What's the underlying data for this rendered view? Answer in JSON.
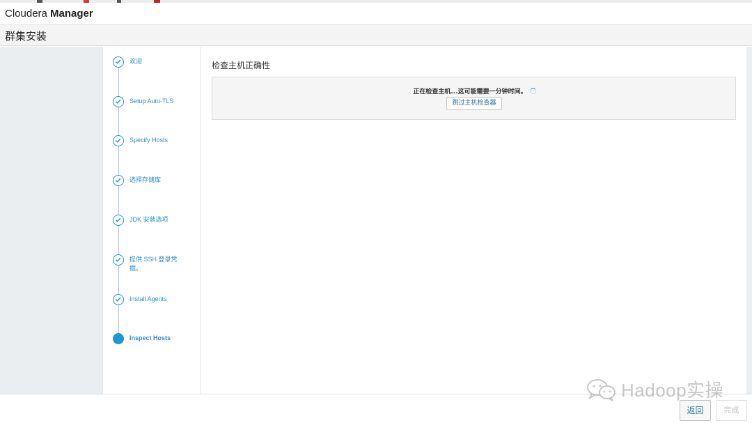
{
  "header": {
    "brand_light": "Cloudera ",
    "brand_bold": "Manager"
  },
  "page": {
    "title": "群集安装"
  },
  "wizard": {
    "steps": [
      {
        "label": "欢迎",
        "status": "completed"
      },
      {
        "label": "Setup Auto-TLS",
        "status": "completed"
      },
      {
        "label": "Specify Hosts",
        "status": "completed"
      },
      {
        "label": "选择存储库",
        "status": "completed"
      },
      {
        "label": "JDK 安装选项",
        "status": "completed"
      },
      {
        "label": "提供 SSH 登录凭据。",
        "status": "completed"
      },
      {
        "label": "Install Agents",
        "status": "completed"
      },
      {
        "label": "Inspect Hosts",
        "status": "current"
      }
    ]
  },
  "main": {
    "section_title": "检查主机正确性",
    "checking_message": "正在检查主机...这可能需要一分钟时间。",
    "skip_button": "跳过主机检查器"
  },
  "footer": {
    "back_button": "返回",
    "finish_button": "完成",
    "finish_disabled": true
  },
  "watermark": {
    "text": "Hadoop实操"
  },
  "colors": {
    "accent": "#1a97d5",
    "link": "#2a8fc7",
    "gutter": "#eaeef1"
  }
}
